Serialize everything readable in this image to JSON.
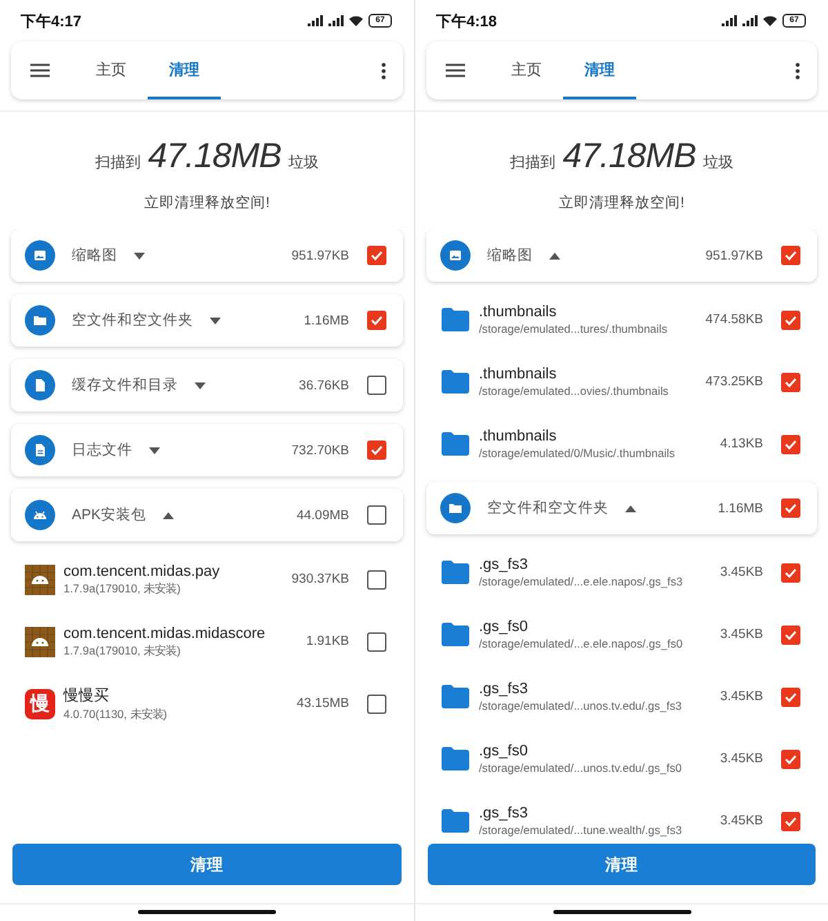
{
  "screens": [
    {
      "status_bar": {
        "time": "下午4:17",
        "battery": "67"
      },
      "tabs": [
        {
          "label": "主页",
          "selected": false
        },
        {
          "label": "清理",
          "selected": true
        }
      ],
      "summary": {
        "prefix": "扫描到",
        "amount": "47.18MB",
        "suffix": "垃圾",
        "subtitle": "立即清理释放空间!"
      },
      "categories": [
        {
          "title": "缩略图",
          "size": "951.97KB",
          "expanded": false,
          "checked": true
        },
        {
          "title": "空文件和空文件夹",
          "size": "1.16MB",
          "expanded": false,
          "checked": true
        },
        {
          "title": "缓存文件和目录",
          "size": "36.76KB",
          "expanded": false,
          "checked": false
        },
        {
          "title": "日志文件",
          "size": "732.70KB",
          "expanded": false,
          "checked": true
        },
        {
          "title": "APK安装包",
          "size": "44.09MB",
          "expanded": true,
          "checked": false,
          "children": [
            {
              "kind": "app",
              "name": "com.tencent.midas.pay",
              "detail": "1.7.9a(179010, 未安装)",
              "size": "930.37KB",
              "checked": false
            },
            {
              "kind": "app",
              "name": "com.tencent.midas.midascore",
              "detail": "1.7.9a(179010, 未安装)",
              "size": "1.91KB",
              "checked": false
            },
            {
              "kind": "app",
              "logo": "慢",
              "name": "慢慢买",
              "detail": "4.0.70(1130, 未安装)",
              "size": "43.15MB",
              "checked": false
            }
          ]
        }
      ],
      "button": "清理"
    },
    {
      "status_bar": {
        "time": "下午4:18",
        "battery": "67"
      },
      "tabs": [
        {
          "label": "主页",
          "selected": false
        },
        {
          "label": "清理",
          "selected": true
        }
      ],
      "summary": {
        "prefix": "扫描到",
        "amount": "47.18MB",
        "suffix": "垃圾",
        "subtitle": "立即清理释放空间!"
      },
      "categories": [
        {
          "title": "缩略图",
          "size": "951.97KB",
          "expanded": true,
          "checked": true,
          "children": [
            {
              "kind": "file",
              "name": ".thumbnails",
              "detail": "/storage/emulated...tures/.thumbnails",
              "size": "474.58KB",
              "checked": true
            },
            {
              "kind": "file",
              "name": ".thumbnails",
              "detail": "/storage/emulated...ovies/.thumbnails",
              "size": "473.25KB",
              "checked": true
            },
            {
              "kind": "file",
              "name": ".thumbnails",
              "detail": "/storage/emulated/0/Music/.thumbnails",
              "size": "4.13KB",
              "checked": true
            }
          ]
        },
        {
          "title": "空文件和空文件夹",
          "size": "1.16MB",
          "expanded": true,
          "checked": true,
          "children": [
            {
              "kind": "file",
              "name": ".gs_fs3",
              "detail": "/storage/emulated/...e.ele.napos/.gs_fs3",
              "size": "3.45KB",
              "checked": true
            },
            {
              "kind": "file",
              "name": ".gs_fs0",
              "detail": "/storage/emulated/...e.ele.napos/.gs_fs0",
              "size": "3.45KB",
              "checked": true
            },
            {
              "kind": "file",
              "name": ".gs_fs3",
              "detail": "/storage/emulated/...unos.tv.edu/.gs_fs3",
              "size": "3.45KB",
              "checked": true
            },
            {
              "kind": "file",
              "name": ".gs_fs0",
              "detail": "/storage/emulated/...unos.tv.edu/.gs_fs0",
              "size": "3.45KB",
              "checked": true
            },
            {
              "kind": "file",
              "name": ".gs_fs3",
              "detail": "/storage/emulated/...tune.wealth/.gs_fs3",
              "size": "3.45KB",
              "checked": true
            }
          ]
        }
      ],
      "button": "清理"
    }
  ]
}
